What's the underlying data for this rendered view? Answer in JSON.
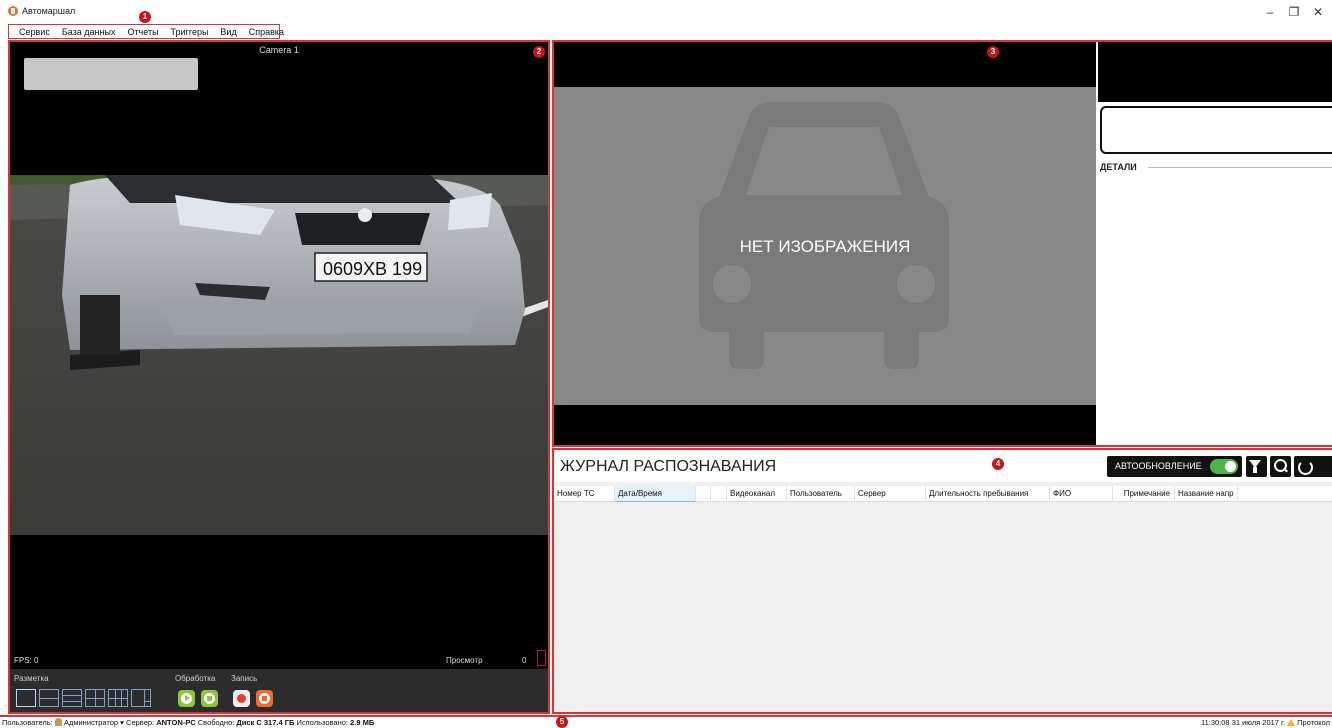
{
  "app": {
    "title": "Автомаршал"
  },
  "window_controls": {
    "minimize": "–",
    "maximize": "❐",
    "close": "✕"
  },
  "menu": [
    "Сервис",
    "База данных",
    "Отчеты",
    "Триггеры",
    "Вид",
    "Справка"
  ],
  "markers": [
    "1",
    "2",
    "3",
    "4",
    "5"
  ],
  "camera": {
    "title": "Camera 1",
    "plate_text": "0609ХВ 199",
    "fps_label": "FPS: 0",
    "mode": "Просмотр",
    "count": "0",
    "toolbar": {
      "layout_label": "Разметка",
      "processing_label": "Обработка",
      "record_label": "Запись"
    }
  },
  "image_panel": {
    "no_image": "НЕТ ИЗОБРАЖЕНИЯ",
    "details_label": "ДЕТАЛИ"
  },
  "journal": {
    "title": "ЖУРНАЛ РАСПОЗНАВАНИЯ",
    "autoupdate_label": "АВТООБНОВЛЕНИЕ",
    "autoupdate_on": true,
    "columns": [
      "Номер ТС",
      "Дата/Время",
      "",
      "Видеоканал",
      "Пользователь",
      "Сервер",
      "Длительность пребывания",
      "ФИО",
      "Примечание",
      "Название напр"
    ]
  },
  "status": {
    "user_label": "Пользователь:",
    "user_value": "Администратор",
    "server_label": "Сервер:",
    "server_value": "ANTON-PC",
    "free_label": "Свободно:",
    "free_value": "Диск C 317.4 ГБ",
    "used_label": "Использовано:",
    "used_value": "2.9 МБ",
    "time": "11:30:08",
    "date": "31 июля 2017 г.",
    "protocol": "Протокол"
  },
  "colors": {
    "accent_red": "#d9343a",
    "toggle_green": "#4bb54b",
    "panel_black": "#000000",
    "placeholder_gray": "#888888"
  }
}
